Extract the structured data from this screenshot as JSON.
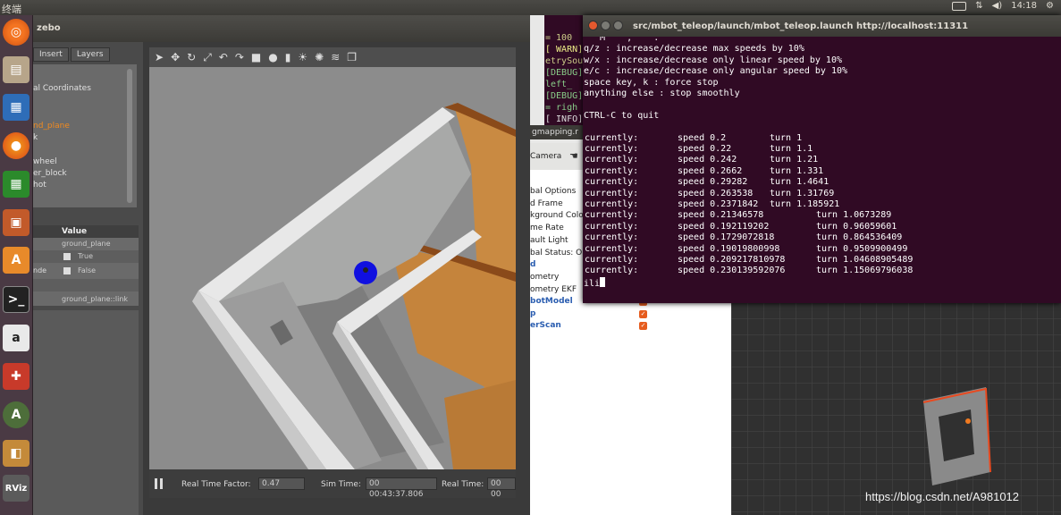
{
  "topbar": {
    "app_title": "终端",
    "clock": "14:18"
  },
  "launcher": {
    "icons": [
      "ubuntu-logo-icon",
      "files-icon",
      "writer-icon",
      "firefox-icon",
      "calc-icon",
      "impress-icon",
      "software-center-icon",
      "terminal-icon",
      "amazon-icon",
      "settings-icon",
      "update-icon",
      "box-icon",
      "rviz-icon"
    ],
    "rviz_label": "RViz"
  },
  "gazebo": {
    "title": "Gazebo",
    "title_visible": "zebo",
    "tabs": [
      "Insert",
      "Layers"
    ],
    "tree": [
      "al Coordinates",
      "nd_plane",
      "k",
      "wheel",
      "er_block",
      "hot"
    ],
    "props_header": "Value",
    "props": [
      {
        "key": "",
        "value": "ground_plane"
      },
      {
        "key": "",
        "value": "True"
      },
      {
        "key": "nde",
        "value": "False"
      },
      {
        "key": "",
        "value": ""
      },
      {
        "key": "",
        "value": "ground_plane::link"
      }
    ],
    "status": {
      "rtf_label": "Real Time Factor:",
      "rtf_value": "0.47",
      "sim_label": "Sim Time:",
      "sim_value": "00 00:43:37.806",
      "real_label": "Real Time:",
      "real_value": "00 00"
    }
  },
  "bg_terminal": {
    "lines": [
      "= 100",
      "[ WARN]",
      "etrySou",
      "[DEBUG]",
      " left_",
      "[DEBUG]",
      "= righ",
      "[ INFO]"
    ]
  },
  "rviz": {
    "window_title": "gmapping.r",
    "camera_label": "Camera",
    "tree": [
      {
        "label": "bal Options",
        "blue": false
      },
      {
        "label": "d Frame",
        "blue": false
      },
      {
        "label": "kground Colo",
        "blue": false
      },
      {
        "label": "me Rate",
        "blue": false
      },
      {
        "label": "ault Light",
        "blue": false
      },
      {
        "label": "bal Status: O",
        "blue": false
      },
      {
        "label": "d",
        "blue": true
      },
      {
        "label": "ometry",
        "blue": false
      },
      {
        "label": "ometry EKF",
        "blue": false
      },
      {
        "label": "botModel",
        "blue": true
      },
      {
        "label": "p",
        "blue": true
      },
      {
        "label": "erScan",
        "blue": true
      }
    ]
  },
  "terminal": {
    "title": "src/mbot_teleop/launch/mbot_teleop.launch http://localhost:11311",
    "partial_top": "   M    ,    .",
    "help": [
      "q/z : increase/decrease max speeds by 10%",
      "w/x : increase/decrease only linear speed by 10%",
      "e/c : increase/decrease only angular speed by 10%",
      "space key, k : force stop",
      "anything else : stop smoothly",
      "",
      "CTRL-C to quit",
      ""
    ],
    "rows": [
      {
        "label": "currently:",
        "speed": "speed 0.2",
        "turn": "turn 1"
      },
      {
        "label": "currently:",
        "speed": "speed 0.22",
        "turn": "turn 1.1"
      },
      {
        "label": "currently:",
        "speed": "speed 0.242",
        "turn": "turn 1.21"
      },
      {
        "label": "currently:",
        "speed": "speed 0.2662",
        "turn": "turn 1.331"
      },
      {
        "label": "currently:",
        "speed": "speed 0.29282",
        "turn": "turn 1.4641"
      },
      {
        "label": "currently:",
        "speed": "speed 0.263538",
        "turn": "turn 1.31769"
      },
      {
        "label": "currently:",
        "speed": "speed 0.2371842",
        "turn": "turn 1.185921"
      },
      {
        "label": "currently:",
        "speed": "speed 0.21346578",
        "turn": "turn 1.0673289"
      },
      {
        "label": "currently:",
        "speed": "speed 0.192119202",
        "turn": "turn 0.96059601"
      },
      {
        "label": "currently:",
        "speed": "speed 0.1729072818",
        "turn": "turn 0.864536409"
      },
      {
        "label": "currently:",
        "speed": "speed 0.19019800998",
        "turn": "turn 0.9509900499"
      },
      {
        "label": "currently:",
        "speed": "speed 0.209217810978",
        "turn": "turn 1.04608905489"
      },
      {
        "label": "currently:",
        "speed": "speed 0.230139592076",
        "turn": "turn 1.15069796038"
      }
    ],
    "prompt": "ili"
  },
  "watermark": "https://blog.csdn.net/A981012",
  "colors": {
    "terminal_bg": "#300a24",
    "launcher_bg": "#4a3a44",
    "robot_blue": "#1010e0",
    "accent_orange": "#e65c1e"
  }
}
